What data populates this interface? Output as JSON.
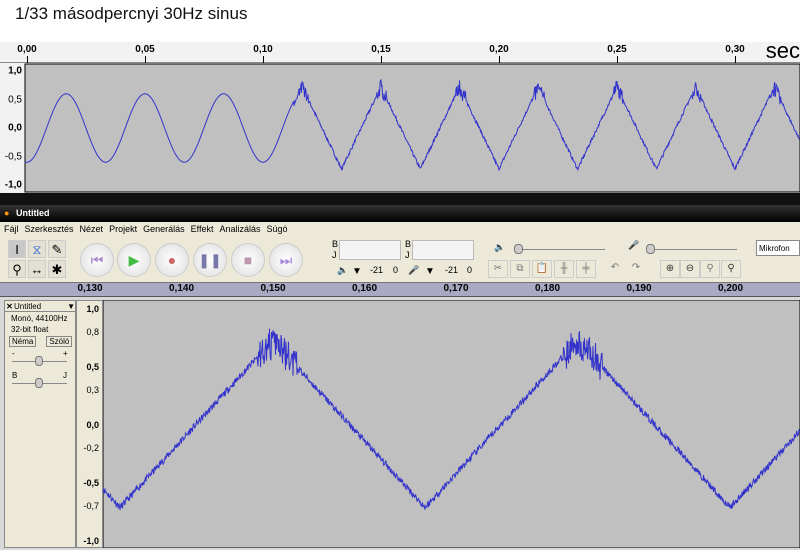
{
  "caption": "1/33 másodpercnyi 30Hz sinus",
  "top_view": {
    "ruler": [
      "0,00",
      "0,05",
      "0,10",
      "0,15",
      "0,20",
      "0,25",
      "0,30"
    ],
    "unit": "sec",
    "amp_labels": [
      "1,0",
      "0,5",
      "0,0",
      "-0,5",
      "-1,0"
    ]
  },
  "window": {
    "title": "Untitled",
    "menu": [
      "Fájl",
      "Szerkesztés",
      "Nézet",
      "Projekt",
      "Generálás",
      "Effekt",
      "Analizálás",
      "Súgó"
    ]
  },
  "meters": {
    "left": "B",
    "right": "J",
    "db_min": "-21",
    "db_max": "0"
  },
  "input_source": "Mikrofon",
  "bottom_view": {
    "ruler": [
      "0,130",
      "0,140",
      "0,150",
      "0,160",
      "0,170",
      "0,180",
      "0,190",
      "0,200"
    ],
    "amp_labels": [
      "1,0",
      "0,8",
      "0,5",
      "0,3",
      "0,0",
      "-0,2",
      "-0,5",
      "-0,7",
      "-1,0"
    ]
  },
  "track": {
    "name": "Untitled",
    "format": "Monó, 44100Hz",
    "depth": "32-bit float",
    "mute": "Néma",
    "solo": "Szóló",
    "gain_minus": "-",
    "gain_plus": "+",
    "pan_left": "B",
    "pan_right": "J"
  },
  "colors": {
    "wave": "#3333cc",
    "wave_bg": "#c0c0c0"
  }
}
